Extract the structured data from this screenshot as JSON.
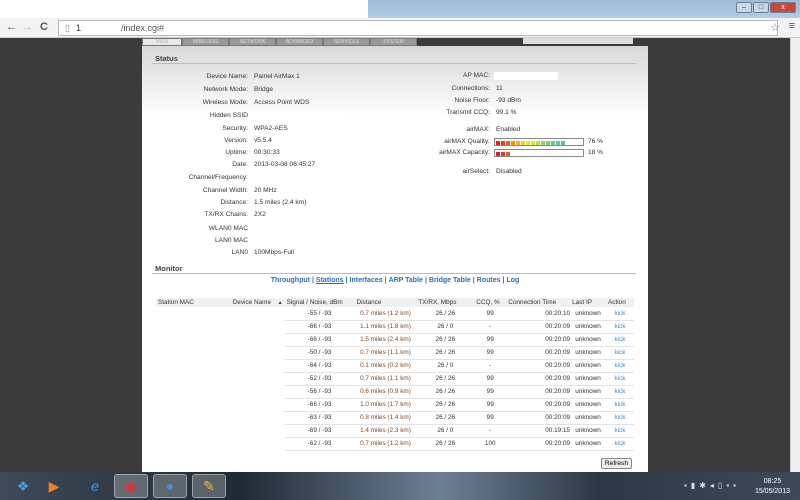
{
  "browser": {
    "url_host": "1",
    "url_path": "/index.cgi#",
    "back": "←",
    "forward": "→",
    "reload": "C"
  },
  "tabs": [
    "MAIN",
    "WIRELESS",
    "NETWORK",
    "ADVANCED",
    "SERVICES",
    "SYSTEM"
  ],
  "status": {
    "title": "Status",
    "left": [
      {
        "k": "Device Name:",
        "v": "Painel AirMax 1"
      },
      {
        "k": "Network Mode:",
        "v": "Bridge"
      },
      {
        "k": "Wireless Mode:",
        "v": "Access Point WDS"
      },
      {
        "k": "Hidden SSID",
        "v": ""
      },
      {
        "k": "Security:",
        "v": "WPA2-AES"
      },
      {
        "k": "Version:",
        "v": "v5.5.4"
      },
      {
        "k": "Uptime:",
        "v": "00:30:33"
      },
      {
        "k": "Date:",
        "v": "2013-03-08 06:45:27"
      },
      {
        "k": "Channel/Frequency:",
        "v": ""
      },
      {
        "k": "Channel Width:",
        "v": "20 MHz"
      },
      {
        "k": "Distance:",
        "v": "1.5 miles (2.4 km)"
      },
      {
        "k": "TX/RX Chains:",
        "v": "2X2"
      },
      {
        "k": "WLAN0 MAC",
        "v": ""
      },
      {
        "k": "LAN0 MAC",
        "v": ""
      },
      {
        "k": "LAN0",
        "v": "100Mbps-Full"
      }
    ],
    "right": {
      "ap_mac": "AP MAC:",
      "connections_k": "Connections:",
      "connections": "11",
      "noise_k": "Noise Floor:",
      "noise": "-93 dBm",
      "ccq_k": "Transmit CCQ:",
      "ccq": "99.1 %",
      "airmax_k": "airMAX:",
      "airmax": "Enabled",
      "quality_k": "airMAX Quality:",
      "quality": "76 %",
      "quality_pct": 76,
      "capacity_k": "airMAX Capacity:",
      "capacity": "18 %",
      "capacity_pct": 18,
      "airselect_k": "airSelect:",
      "airselect": "Disabled"
    }
  },
  "monitor": {
    "title": "Monitor",
    "links": [
      "Throughput",
      "Stations",
      "Interfaces",
      "ARP Table",
      "Bridge Table",
      "Routes",
      "Log"
    ],
    "sep": "|",
    "columns": [
      "Station MAC",
      "Device Name",
      "▲",
      "Signal / Noise, dBm",
      "Distance",
      "TX/RX, Mbps",
      "CCQ, %",
      "Connection Time",
      "Last IP",
      "Action"
    ],
    "rows": [
      [
        "-55 / -93",
        "0.7 miles (1.2 km)",
        "26 / 26",
        "99",
        "00:20:10",
        "unknown",
        "kick"
      ],
      [
        "-66 / -93",
        "1.1 miles (1.8 km)",
        "26 / 0",
        "-",
        "00:20:09",
        "unknown",
        "kick"
      ],
      [
        "-66 / -93",
        "1.5 miles (2.4 km)",
        "26 / 26",
        "99",
        "00:20:09",
        "unknown",
        "kick"
      ],
      [
        "-50 / -93",
        "0.7 miles (1.1 km)",
        "26 / 26",
        "99",
        "00:20:09",
        "unknown",
        "kick"
      ],
      [
        "-64 / -93",
        "0.1 miles (0.2 km)",
        "26 / 0",
        "-",
        "00:20:09",
        "unknown",
        "kick"
      ],
      [
        "-52 / -93",
        "0.7 miles (1.1 km)",
        "26 / 26",
        "99",
        "00:20:09",
        "unknown",
        "kick"
      ],
      [
        "-56 / -93",
        "0.6 miles (0.9 km)",
        "26 / 26",
        "99",
        "00:20:09",
        "unknown",
        "kick"
      ],
      [
        "-66 / -93",
        "1.0 miles (1.7 km)",
        "26 / 26",
        "99",
        "00:20:09",
        "unknown",
        "kick"
      ],
      [
        "-63 / -93",
        "0.8 miles (1.4 km)",
        "26 / 26",
        "99",
        "00:20:09",
        "unknown",
        "kick"
      ],
      [
        "-69 / -93",
        "1.4 miles (2.3 km)",
        "26 / 0",
        "-",
        "00:19:15",
        "unknown",
        "kick"
      ],
      [
        "-62 / -93",
        "0.7 miles (1.2 km)",
        "26 / 26",
        "100",
        "00:20:09",
        "unknown",
        "kick"
      ]
    ],
    "refresh": "Refresh"
  },
  "taskbar": {
    "time": "08:25",
    "date": "15/05/2013"
  }
}
